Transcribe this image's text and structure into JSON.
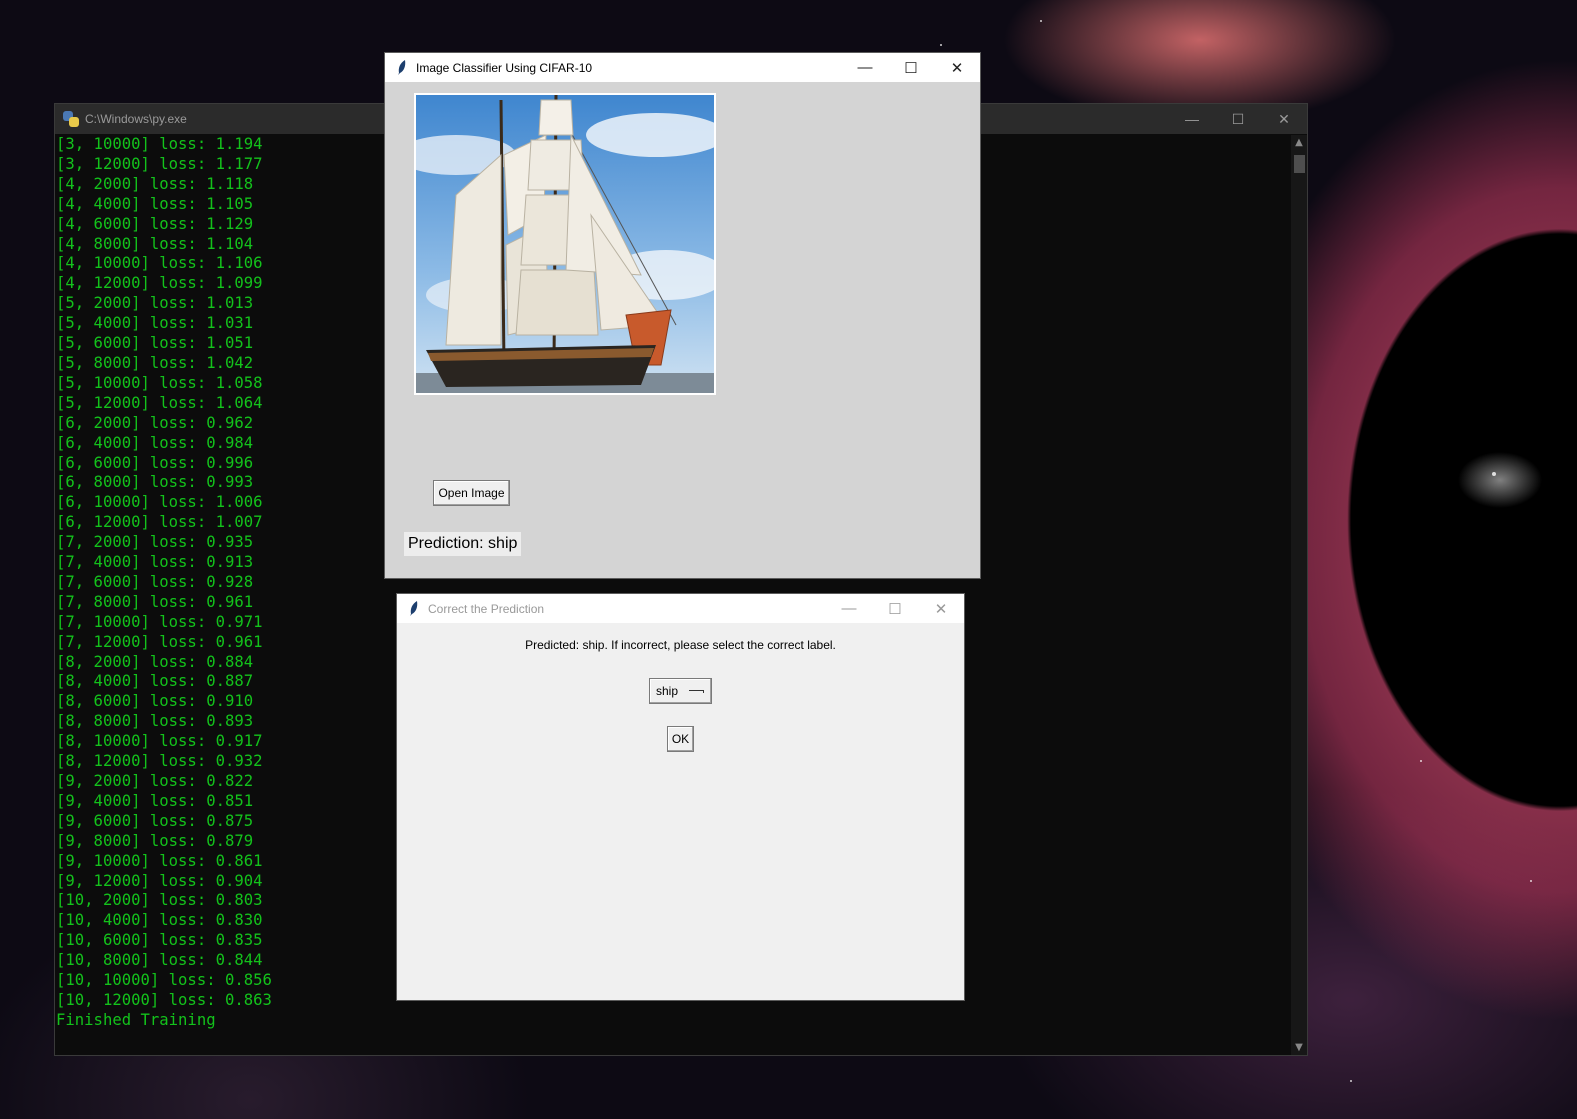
{
  "console": {
    "title": "C:\\Windows\\py.exe",
    "lines": [
      "[3, 10000] loss: 1.194",
      "[3, 12000] loss: 1.177",
      "[4, 2000] loss: 1.118",
      "[4, 4000] loss: 1.105",
      "[4, 6000] loss: 1.129",
      "[4, 8000] loss: 1.104",
      "[4, 10000] loss: 1.106",
      "[4, 12000] loss: 1.099",
      "[5, 2000] loss: 1.013",
      "[5, 4000] loss: 1.031",
      "[5, 6000] loss: 1.051",
      "[5, 8000] loss: 1.042",
      "[5, 10000] loss: 1.058",
      "[5, 12000] loss: 1.064",
      "[6, 2000] loss: 0.962",
      "[6, 4000] loss: 0.984",
      "[6, 6000] loss: 0.996",
      "[6, 8000] loss: 0.993",
      "[6, 10000] loss: 1.006",
      "[6, 12000] loss: 1.007",
      "[7, 2000] loss: 0.935",
      "[7, 4000] loss: 0.913",
      "[7, 6000] loss: 0.928",
      "[7, 8000] loss: 0.961",
      "[7, 10000] loss: 0.971",
      "[7, 12000] loss: 0.961",
      "[8, 2000] loss: 0.884",
      "[8, 4000] loss: 0.887",
      "[8, 6000] loss: 0.910",
      "[8, 8000] loss: 0.893",
      "[8, 10000] loss: 0.917",
      "[8, 12000] loss: 0.932",
      "[9, 2000] loss: 0.822",
      "[9, 4000] loss: 0.851",
      "[9, 6000] loss: 0.875",
      "[9, 8000] loss: 0.879",
      "[9, 10000] loss: 0.861",
      "[9, 12000] loss: 0.904",
      "[10, 2000] loss: 0.803",
      "[10, 4000] loss: 0.830",
      "[10, 6000] loss: 0.835",
      "[10, 8000] loss: 0.844",
      "[10, 10000] loss: 0.856",
      "[10, 12000] loss: 0.863",
      "Finished Training"
    ],
    "text_color": "#13c21b"
  },
  "classifier_window": {
    "title": "Image Classifier Using CIFAR-10",
    "open_button": "Open Image",
    "prediction": "Prediction: ship"
  },
  "correction_dialog": {
    "title": "Correct the Prediction",
    "message": "Predicted: ship. If incorrect, please select the correct label.",
    "selected_label": "ship",
    "ok_button": "OK"
  },
  "window_controls": {
    "minimize": "—",
    "maximize": "☐",
    "close": "✕"
  }
}
